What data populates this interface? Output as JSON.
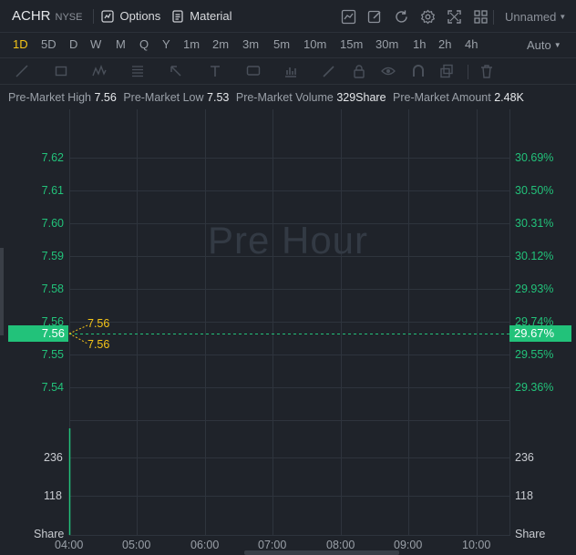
{
  "header": {
    "symbol": "ACHR",
    "exchange": "NYSE",
    "options_label": "Options",
    "material_label": "Material",
    "layout_name": "Unnamed"
  },
  "periods": [
    "1D",
    "5D",
    "D",
    "W",
    "M",
    "Q",
    "Y",
    "1m",
    "2m",
    "3m",
    "5m",
    "10m",
    "15m",
    "30m",
    "1h",
    "2h",
    "4h"
  ],
  "active_period": "1D",
  "chart_mode": "Auto",
  "info": {
    "high_label": "Pre-Market High",
    "high_value": "7.56",
    "low_label": "Pre-Market Low",
    "low_value": "7.53",
    "volume_label": "Pre-Market Volume",
    "volume_value": "329Share",
    "amount_label": "Pre-Market Amount",
    "amount_value": "2.48K"
  },
  "watermark": "Pre Hour",
  "colors": {
    "up": "#22c27a",
    "accent": "#f5c518",
    "background": "#1f232a"
  },
  "chart_data": {
    "type": "line",
    "price_axis": [
      "7.62",
      "7.61",
      "7.60",
      "7.59",
      "7.58",
      "7.56",
      "7.55",
      "7.54"
    ],
    "percent_axis": [
      "30.69%",
      "30.50%",
      "30.31%",
      "30.12%",
      "29.93%",
      "29.74%",
      "29.55%",
      "29.36%"
    ],
    "current_price": "7.56",
    "current_percent": "29.67%",
    "marker_labels": [
      "7.56",
      "7.56"
    ],
    "volume_axis": [
      "236",
      "118"
    ],
    "volume_unit": "Share",
    "x_ticks": [
      "04:00",
      "05:00",
      "06:00",
      "07:00",
      "08:00",
      "09:00",
      "10:00"
    ]
  }
}
